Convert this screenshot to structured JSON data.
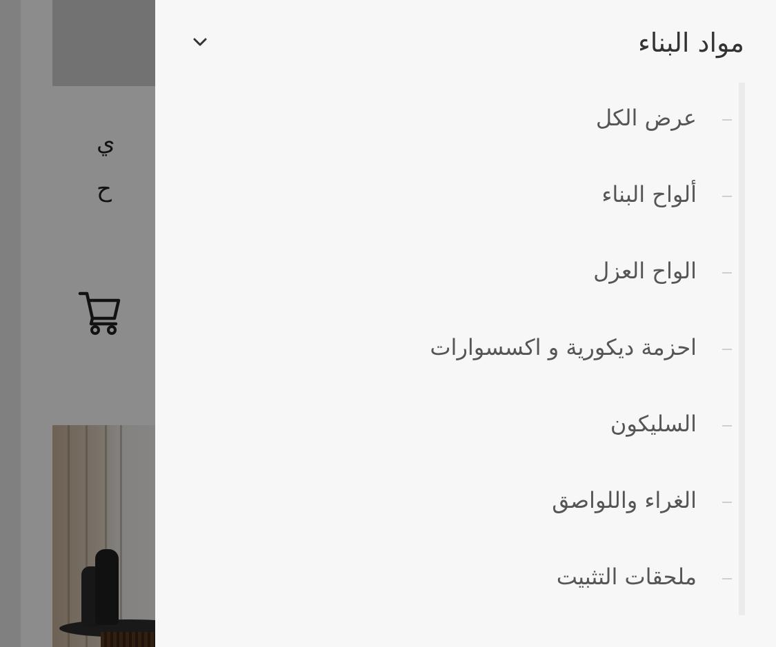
{
  "background": {
    "product_title_line1": "ي",
    "product_title_line2": "ح",
    "cart_icon": "cart-icon"
  },
  "drawer": {
    "title": "مواد البناء",
    "toggle_icon": "chevron-down-icon",
    "items": [
      {
        "label": "عرض الكل"
      },
      {
        "label": "ألواح البناء"
      },
      {
        "label": "الواح العزل"
      },
      {
        "label": "احزمة ديكورية و اكسسوارات"
      },
      {
        "label": "السليكون"
      },
      {
        "label": "الغراء واللواصق"
      },
      {
        "label": "ملحقات التثبيت"
      }
    ]
  },
  "colors": {
    "drawer_bg": "#f7f7f7",
    "overlay": "rgba(0,0,0,0.45)",
    "text_primary": "#333333",
    "text_secondary": "#555555"
  }
}
